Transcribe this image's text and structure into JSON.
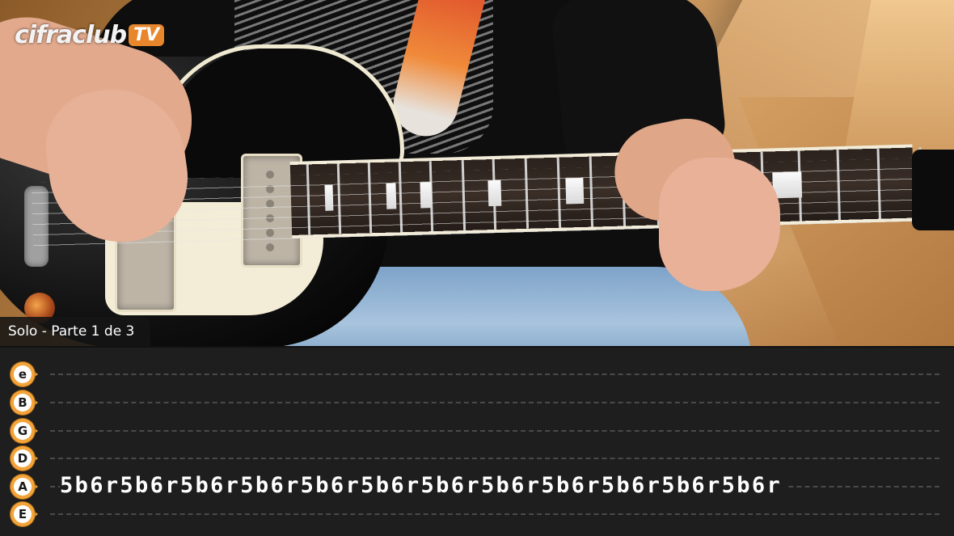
{
  "logo": {
    "text": "cifraclub",
    "suffix": "TV"
  },
  "caption": {
    "text": "Solo - Parte 1 de 3"
  },
  "tab": {
    "strings": [
      {
        "name": "e",
        "notes": ""
      },
      {
        "name": "B",
        "notes": ""
      },
      {
        "name": "G",
        "notes": ""
      },
      {
        "name": "D",
        "notes": ""
      },
      {
        "name": "A",
        "notes": "5b6r5b6r5b6r5b6r5b6r5b6r5b6r5b6r5b6r5b6r5b6r5b6r"
      },
      {
        "name": "E",
        "notes": ""
      }
    ]
  },
  "colors": {
    "badge_accent": "#f2a33a",
    "tab_background": "#1e1e1e",
    "logo_accent": "#e8862c"
  }
}
